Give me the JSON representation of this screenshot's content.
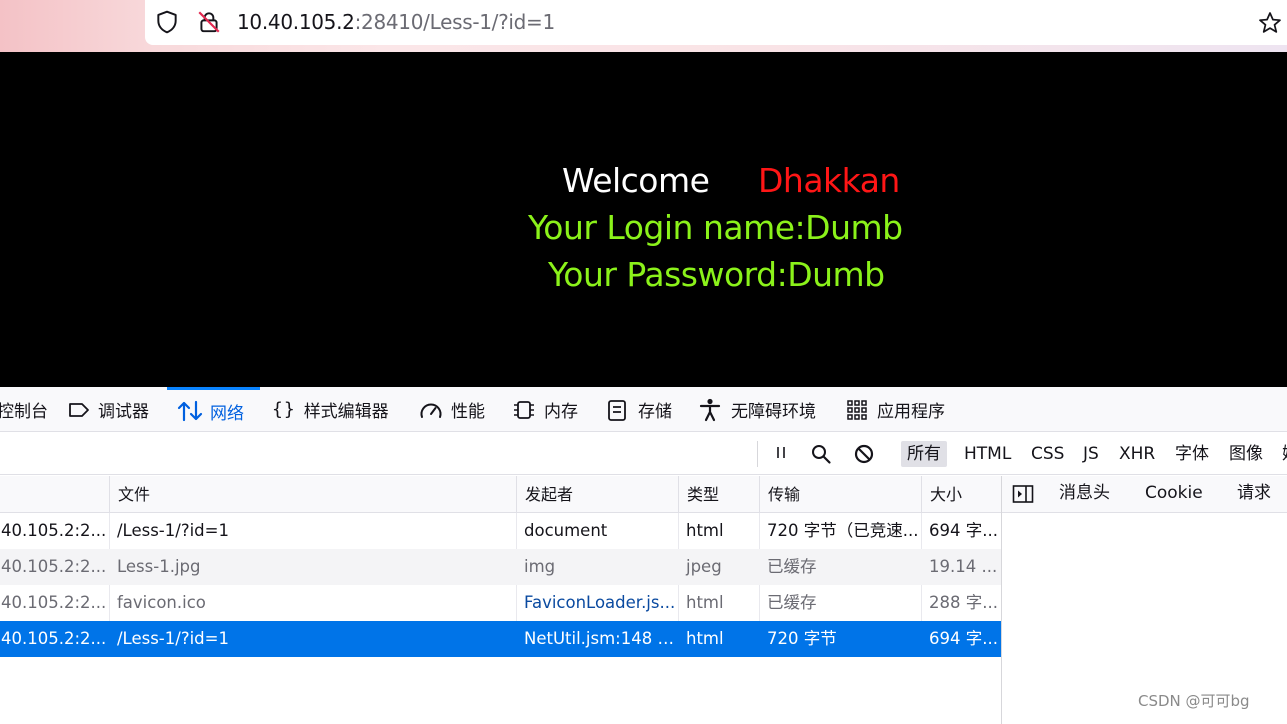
{
  "browser": {
    "url_host": "10.40.105.2",
    "url_rest": ":28410/Less-1/?id=1",
    "icons": [
      "shield-icon",
      "insecure-lock-icon",
      "bookmark-star-icon"
    ]
  },
  "page": {
    "welcome": "Welcome",
    "name": "Dhakkan",
    "login_line": "Your Login name:Dumb",
    "password_line": "Your Password:Dumb",
    "colors": {
      "background": "#000000",
      "welcome": "#ffffff",
      "name": "#ff1616",
      "info": "#8bf21a"
    }
  },
  "devtools": {
    "tabs": [
      {
        "label": "控制台",
        "icon": "console-icon"
      },
      {
        "label": "调试器",
        "icon": "debugger-icon"
      },
      {
        "label": "网络",
        "icon": "network-arrows-icon",
        "active": true
      },
      {
        "label": "样式编辑器",
        "icon": "braces-icon"
      },
      {
        "label": "性能",
        "icon": "gauge-icon"
      },
      {
        "label": "内存",
        "icon": "chip-icon"
      },
      {
        "label": "存储",
        "icon": "storage-icon"
      },
      {
        "label": "无障碍环境",
        "icon": "accessibility-icon"
      },
      {
        "label": "应用程序",
        "icon": "grid-icon"
      }
    ],
    "toolbar": {
      "icons": [
        "pause-icon",
        "search-icon",
        "block-icon"
      ],
      "filters": [
        "所有",
        "HTML",
        "CSS",
        "JS",
        "XHR",
        "字体",
        "图像",
        "媒"
      ],
      "selected_filter": "所有"
    },
    "table": {
      "columns": [
        "文件",
        "发起者",
        "类型",
        "传输",
        "大小"
      ],
      "rows": [
        {
          "domain": "40.105.2:2...",
          "file": "/Less-1/?id=1",
          "initiator": "document",
          "type": "html",
          "transfer": "720 字节（已竞速...",
          "size": "694 字..."
        },
        {
          "domain": "40.105.2:2...",
          "file": "Less-1.jpg",
          "initiator": "img",
          "type": "jpeg",
          "transfer": "已缓存",
          "size": "19.14 ..."
        },
        {
          "domain": "40.105.2:2...",
          "file": "favicon.ico",
          "initiator": "FaviconLoader.js...",
          "type": "html",
          "transfer": "已缓存",
          "size": "288 字..."
        },
        {
          "domain": "40.105.2:2...",
          "file": "/Less-1/?id=1",
          "initiator": "NetUtil.jsm:148 (...",
          "type": "html",
          "transfer": "720 字节",
          "size": "694 字..."
        }
      ]
    },
    "side_panel": {
      "icon": "panel-toggle-icon",
      "tabs": [
        "消息头",
        "Cookie",
        "请求"
      ]
    }
  },
  "watermark": "CSDN @可可bg"
}
